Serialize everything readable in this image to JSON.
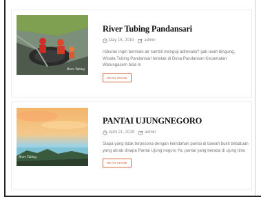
{
  "posts": [
    {
      "title": "River Tubing Pandansari",
      "date": "May 16, 2019",
      "author": "admin",
      "excerpt": "Hiburan ingin bermain air sambil menguji adrenalin? gak usah bingung, Wisata Tubing Pandansari terletak di Desa Pandansari Kecamatan Warungasem bisa m",
      "read_more": "READ MORE",
      "image_caption": "River Tubing"
    },
    {
      "title": "PANTAI UJUNGNEGORO",
      "date": "April 21, 2019",
      "author": "admin",
      "excerpt": "Siapa yang tidak terpesona dengan keindahan pantai di bawah bukit bebatuan yang akrab disapa Pantai Ujung negoro Ya, pantai yang berada di ujung timu",
      "read_more": "READ MORE"
    }
  ],
  "colors": {
    "accent": "#d8683f",
    "title": "#111111",
    "meta": "#888888"
  },
  "icons": [
    "clock-icon",
    "edit-icon"
  ]
}
